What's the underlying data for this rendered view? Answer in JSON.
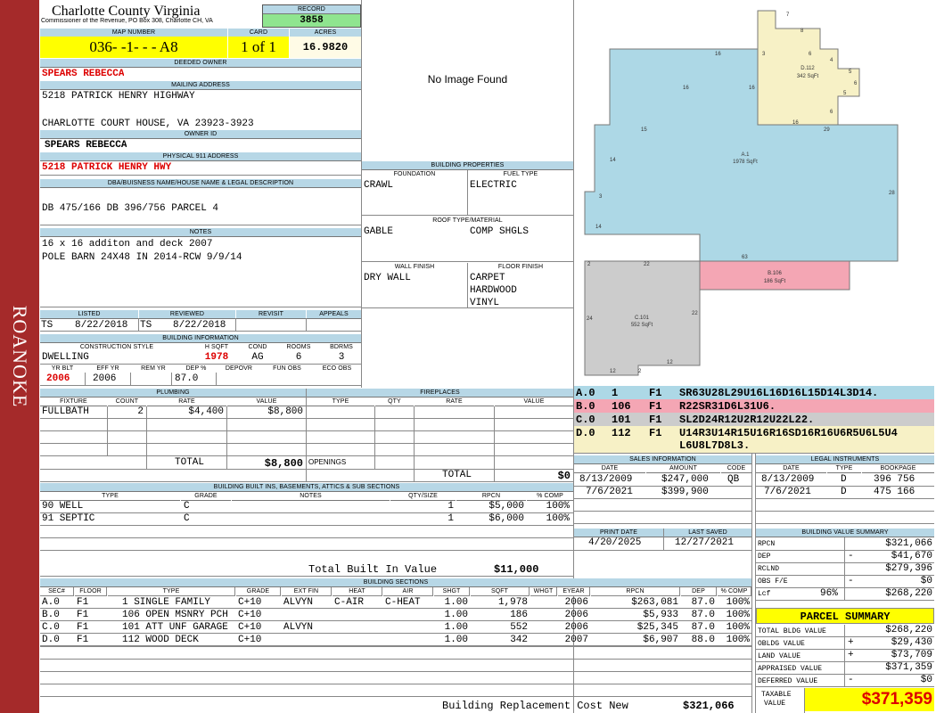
{
  "sidebar": {
    "label": "ROANOKE"
  },
  "county": {
    "name": "Charlotte County Virginia",
    "commissioner": "Commissioner of the Revenue, PO Box 308, Charlotte CH, VA"
  },
  "record": {
    "label": "RECORD",
    "value": "3858"
  },
  "map": {
    "label": "MAP NUMBER",
    "value": "036-  -1-  -  - A8"
  },
  "card": {
    "label": "CARD",
    "value": "1 of 1"
  },
  "acres": {
    "label": "ACRES",
    "value": "16.9820"
  },
  "owner": {
    "label": "DEEDED OWNER",
    "value": "SPEARS REBECCA"
  },
  "mailing": {
    "label": "MAILING ADDRESS",
    "line1": "5218 PATRICK HENRY HIGHWAY",
    "line2": "CHARLOTTE COURT HOUSE, VA 23923-3923"
  },
  "owner_id": {
    "label": "OWNER ID",
    "value": "SPEARS REBECCA"
  },
  "physical": {
    "label": "PHYSICAL 911 ADDRESS",
    "value": "5218 PATRICK HENRY HWY"
  },
  "legal_desc": {
    "label": "DBA/BUISNESS NAME/HOUSE NAME & LEGAL DESCRIPTION",
    "value": "DB 475/166 DB 396/756 PARCEL 4"
  },
  "notes": {
    "label": "NOTES",
    "line1": "16 x 16 additon and deck 2007",
    "line2": "POLE BARN 24X48 IN 2014-RCW 9/9/14"
  },
  "review": {
    "listed_label": "LISTED",
    "reviewed_label": "REVIEWED",
    "revisit_label": "REVISIT",
    "appeals_label": "APPEALS",
    "listed_by": "TS",
    "listed_date": "8/22/2018",
    "reviewed_by": "TS",
    "reviewed_date": "8/22/2018"
  },
  "building_info": {
    "label": "BUILDING INFORMATION",
    "style_label": "CONSTRUCTION STYLE",
    "hsqft_label": "H SQFT",
    "cond_label": "COND",
    "rooms_label": "ROOMS",
    "bdrms_label": "BDRMS",
    "style": "DWELLING",
    "hsqft": "1978",
    "cond": "AG",
    "rooms": "6",
    "bdrms": "3",
    "yrblt_label": "YR BLT",
    "effyr_label": "EFF YR",
    "remyr_label": "REM YR",
    "dep_label": "DEP %",
    "depovr_label": "DEPOVR",
    "funobs_label": "FUN OBS",
    "ecoobs_label": "ECO OBS",
    "yrblt": "2006",
    "effyr": "2006",
    "dep": "87.0"
  },
  "photo": {
    "text": "No Image Found"
  },
  "building_props": {
    "label": "BUILDING PROPERTIES",
    "foundation_label": "FOUNDATION",
    "fuel_label": "FUEL TYPE",
    "foundation": "CRAWL",
    "fuel": "ELECTRIC",
    "roof_label": "ROOF TYPE/MATERIAL",
    "roof1": "GABLE",
    "roof2": "COMP SHGLS",
    "wall_label": "WALL FINISH",
    "floor_label": "FLOOR FINISH",
    "wall": "DRY WALL",
    "floor1": "CARPET",
    "floor2": "HARDWOOD",
    "floor3": "VINYL"
  },
  "plumbing": {
    "label": "PLUMBING",
    "headers": [
      "FIXTURE",
      "COUNT",
      "RATE",
      "VALUE"
    ],
    "rows": [
      {
        "fixture": "FULLBATH",
        "count": "2",
        "rate": "$4,400",
        "value": "$8,800"
      }
    ],
    "total_label": "TOTAL",
    "total": "$8,800"
  },
  "fireplaces": {
    "label": "FIREPLACES",
    "headers": [
      "TYPE",
      "QTY",
      "RATE",
      "VALUE"
    ],
    "openings_label": "OPENINGS",
    "total_label": "TOTAL",
    "total": "$0"
  },
  "builtins": {
    "label": "BUILDING BUILT INS, BASEMENTS, ATTICS & SUB SECTIONS",
    "headers": [
      "TYPE",
      "GRADE",
      "NOTES",
      "QTY/SIZE",
      "RPCN",
      "% COMP"
    ],
    "rows": [
      {
        "type": "90 WELL",
        "grade": "C",
        "qty": "1",
        "rpcn": "$5,000",
        "comp": "100%"
      },
      {
        "type": "91 SEPTIC",
        "grade": "C",
        "qty": "1",
        "rpcn": "$6,000",
        "comp": "100%"
      }
    ],
    "total_label": "Total Built In Value",
    "total": "$11,000"
  },
  "sketch": {
    "colors": {
      "A": "#add8e6",
      "B": "#f4a6b4",
      "C": "#cccccc",
      "D": "#f7f1c6"
    },
    "labels": [
      {
        "id": "A.1",
        "area": "1978 SqFt"
      },
      {
        "id": "B.106",
        "area": "186 SqFt"
      },
      {
        "id": "C.101",
        "area": "552 SqFt"
      },
      {
        "id": "D.112",
        "area": "342 SqFt"
      }
    ],
    "dims": [
      "7",
      "8",
      "16",
      "3",
      "6",
      "4",
      "5",
      "6",
      "5",
      "16",
      "16",
      "6",
      "16",
      "29",
      "15",
      "14",
      "28",
      "3",
      "14",
      "63",
      "2",
      "22",
      "22",
      "24",
      "12",
      "2",
      "12"
    ]
  },
  "segments": [
    {
      "sec": "A.0",
      "code": "1",
      "floor": "F1",
      "path": "SR63U28L29U16L16D16L15D14L3D14.",
      "color": "#add8e6"
    },
    {
      "sec": "B.0",
      "code": "106",
      "floor": "F1",
      "path": "R22SR31D6L31U6.",
      "color": "#f4a6b4"
    },
    {
      "sec": "C.0",
      "code": "101",
      "floor": "F1",
      "path": "SL2D24R12U2R12U22L22.",
      "color": "#cccccc"
    },
    {
      "sec": "D.0",
      "code": "112",
      "floor": "F1",
      "path": "U14R3U14R15U16R16SD16R16U6R5U6L5U4",
      "path2": "L6U8L7D8L3.",
      "color": "#f7f1c6"
    }
  ],
  "sales": {
    "label": "SALES INFORMATION",
    "headers": [
      "DATE",
      "AMOUNT",
      "CODE"
    ],
    "rows": [
      {
        "date": "8/13/2009",
        "amount": "$247,000",
        "code": "QB"
      },
      {
        "date": "7/6/2021",
        "amount": "$399,900",
        "code": ""
      }
    ]
  },
  "legal": {
    "label": "LEGAL INSTRUMENTS",
    "headers": [
      "DATE",
      "TYPE",
      "BOOKPAGE"
    ],
    "rows": [
      {
        "date": "8/13/2009",
        "type": "D",
        "book": "396 756"
      },
      {
        "date": "7/6/2021",
        "type": "D",
        "book": "475 166"
      }
    ]
  },
  "dates": {
    "print_label": "PRINT DATE",
    "saved_label": "LAST SAVED",
    "print": "4/20/2025",
    "saved": "12/27/2021"
  },
  "value_summary": {
    "label": "BUILDING VALUE SUMMARY",
    "rpcn_label": "RPCN",
    "rpcn": "$321,066",
    "dep_label": "DEP",
    "dep_sign": "-",
    "dep": "$41,670",
    "rclnd_label": "RCLND",
    "rclnd": "$279,396",
    "obs_label": "OBS F/E",
    "obs_sign": "-",
    "obs": "$0",
    "lcf_label": "Lcf",
    "lcf_pct": "96%",
    "lcf": "$268,220"
  },
  "parcel": {
    "label": "PARCEL SUMMARY",
    "rows": [
      {
        "label": "TOTAL BLDG VALUE",
        "sign": "",
        "value": "$268,220"
      },
      {
        "label": "OBLDG VALUE",
        "sign": "+",
        "value": "$29,430"
      },
      {
        "label": "LAND VALUE",
        "sign": "+",
        "value": "$73,709"
      },
      {
        "label": "APPRAISED VALUE",
        "sign": "",
        "value": "$371,359"
      },
      {
        "label": "DEFERRED VALUE",
        "sign": "-",
        "value": "$0"
      }
    ],
    "taxable_label1": "TAXABLE",
    "taxable_label2": "VALUE",
    "taxable": "$371,359"
  },
  "sections": {
    "label": "BUILDING SECTIONS",
    "headers": [
      "SEC#",
      "FLOOR",
      "TYPE",
      "GRADE",
      "EXT FIN",
      "HEAT",
      "AIR",
      "SHGT",
      "SQFT",
      "WHGT",
      "EYEAR",
      "RPCN",
      "DEP",
      "% COMP"
    ],
    "rows": [
      {
        "sec": "A.0",
        "floor": "F1",
        "type": "1 SINGLE FAMILY",
        "grade": "C+10",
        "ext": "ALVYN",
        "heat": "C-AIR",
        "air": "C-HEAT",
        "shgt": "1.00",
        "sqft": "1,978",
        "eyear": "2006",
        "rpcn": "$263,081",
        "dep": "87.0",
        "comp": "100%"
      },
      {
        "sec": "B.0",
        "floor": "F1",
        "type": "106 OPEN MSNRY PCH",
        "grade": "C+10",
        "ext": "",
        "heat": "",
        "air": "",
        "shgt": "1.00",
        "sqft": "186",
        "eyear": "2006",
        "rpcn": "$5,933",
        "dep": "87.0",
        "comp": "100%"
      },
      {
        "sec": "C.0",
        "floor": "F1",
        "type": "101 ATT UNF GARAGE",
        "grade": "C+10",
        "ext": "ALVYN",
        "heat": "",
        "air": "",
        "shgt": "1.00",
        "sqft": "552",
        "eyear": "2006",
        "rpcn": "$25,345",
        "dep": "87.0",
        "comp": "100%"
      },
      {
        "sec": "D.0",
        "floor": "F1",
        "type": "112 WOOD DECK",
        "grade": "C+10",
        "ext": "",
        "heat": "",
        "air": "",
        "shgt": "1.00",
        "sqft": "342",
        "eyear": "2007",
        "rpcn": "$6,907",
        "dep": "88.0",
        "comp": "100%"
      }
    ],
    "total_label": "Building Replacement Cost New",
    "total": "$321,066"
  }
}
